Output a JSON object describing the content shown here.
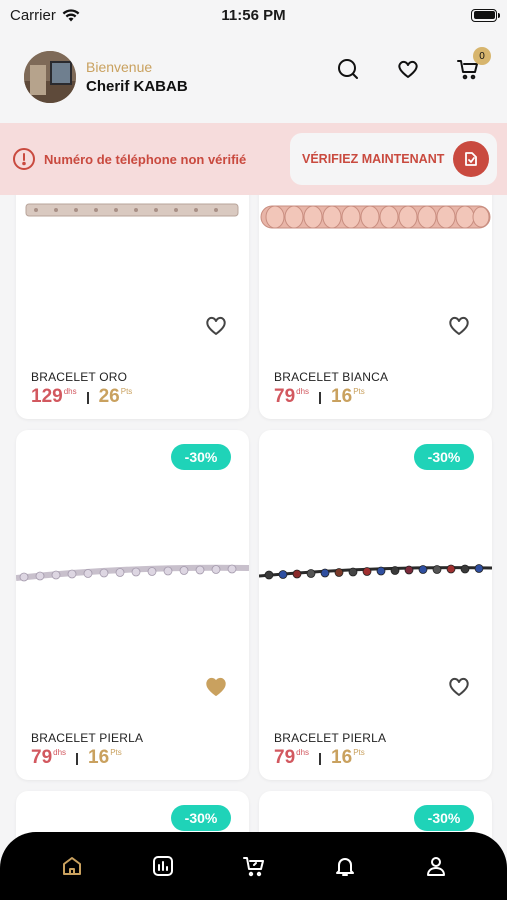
{
  "status_bar": {
    "carrier": "Carrier",
    "time": "11:56 PM"
  },
  "header": {
    "welcome": "Bienvenue",
    "username": "Cherif KABAB",
    "cart_count": "0"
  },
  "alert": {
    "message": "Numéro de téléphone non vérifié",
    "action_label": "VÉRIFIEZ MAINTENANT"
  },
  "products": [
    {
      "name": "BRACELET ORO",
      "price": "129",
      "price_unit": "dhs",
      "points": "26",
      "points_unit": "Pts",
      "discount": "",
      "favorite": false
    },
    {
      "name": "BRACELET BIANCA",
      "price": "79",
      "price_unit": "dhs",
      "points": "16",
      "points_unit": "Pts",
      "discount": "",
      "favorite": false
    },
    {
      "name": "BRACELET PIERLA",
      "price": "79",
      "price_unit": "dhs",
      "points": "16",
      "points_unit": "Pts",
      "discount": "-30%",
      "favorite": true
    },
    {
      "name": "BRACELET PIERLA",
      "price": "79",
      "price_unit": "dhs",
      "points": "16",
      "points_unit": "Pts",
      "discount": "-30%",
      "favorite": false
    },
    {
      "discount": "-30%"
    },
    {
      "discount": "-30%"
    }
  ],
  "colors": {
    "accent_gold": "#c9a15f",
    "price_red": "#d2585f",
    "alert_red": "#c94a3f",
    "discount_teal": "#1fd3b8",
    "favorite_gold": "#c9a15f"
  },
  "bottom_nav": [
    "home-icon",
    "stats-icon",
    "cart-icon",
    "bell-icon",
    "profile-icon"
  ]
}
